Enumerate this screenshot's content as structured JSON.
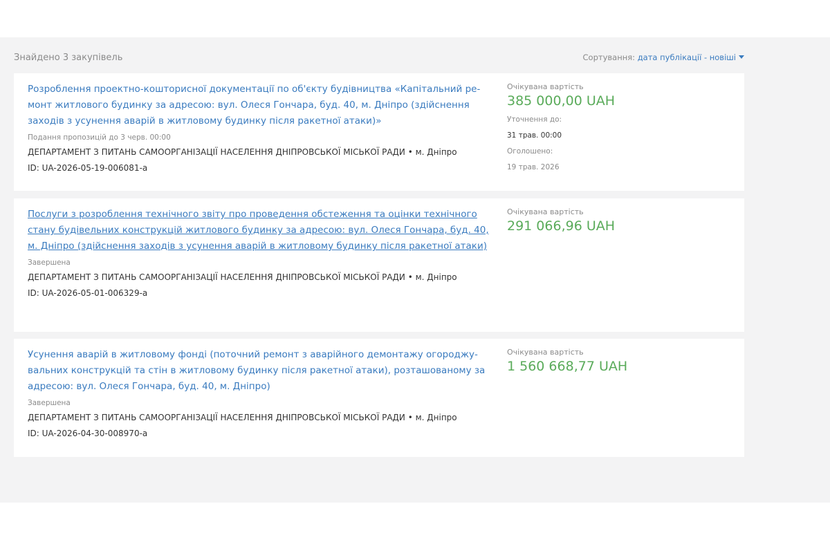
{
  "header": {
    "found_text": "Знайдено 3 закупівель",
    "sort_label": "Сортування:",
    "sort_value": "дата публікації - новіші"
  },
  "tenders": [
    {
      "title": "Розроблення проектно-кошторисної документації по об'єкту будівництва «Капітальний ре-монт житлового будинку за адресою: вул. Олеся Гончара, буд. 40, м. Дніпро (здійснення заходів з усунення аварій в житловому будинку після ракетної атаки)»",
      "status": "Подання пропозицій до 3 черв. 00:00",
      "organization": "ДЕПАРТАМЕНТ З ПИТАНЬ САМООРГАНІЗАЦІЇ НАСЕЛЕННЯ ДНІПРОВСЬКОЇ МІСЬКОЇ РАДИ • м. Дніпро",
      "id": "ID: UA-2026-05-19-006081-a",
      "expected_label": "Очікувана вартість",
      "amount": "385 000,00 UAH",
      "clarify_label": "Уточнення до:",
      "clarify_value": "31 трав. 00:00",
      "announced_label": "Оголошено:",
      "announced_value": "19 трав. 2026"
    },
    {
      "title": "Послуги з розроблення технічного звіту про проведення обстеження та оцінки технічного стану будівельних конструкцій житлового будинку за адресою: вул. Олеся Гончара, буд. 40, м. Дніпро (здійснення заходів з усунення аварій в житловому будинку після ракетної атаки)",
      "status": "Завершена",
      "organization": "ДЕПАРТАМЕНТ З ПИТАНЬ САМООРГАНІЗАЦІЇ НАСЕЛЕННЯ ДНІПРОВСЬКОЇ МІСЬКОЇ РАДИ • м. Дніпро",
      "id": "ID: UA-2026-05-01-006329-a",
      "expected_label": "Очікувана вартість",
      "amount": "291 066,96 UAH"
    },
    {
      "title": "Усунення аварій в житловому фонді (поточний ремонт з аварійного демонтажу огороджу-вальних конструкцій та стін в житловому будинку після ракетної атаки), розташованому за адресою: вул. Олеся Гончара, буд. 40, м. Дніпро)",
      "status": "Завершена",
      "organization": "ДЕПАРТАМЕНТ З ПИТАНЬ САМООРГАНІЗАЦІЇ НАСЕЛЕННЯ ДНІПРОВСЬКОЇ МІСЬКОЇ РАДИ • м. Дніпро",
      "id": "ID: UA-2026-04-30-008970-a",
      "expected_label": "Очікувана вартість",
      "amount": "1 560 668,77 UAH"
    }
  ]
}
